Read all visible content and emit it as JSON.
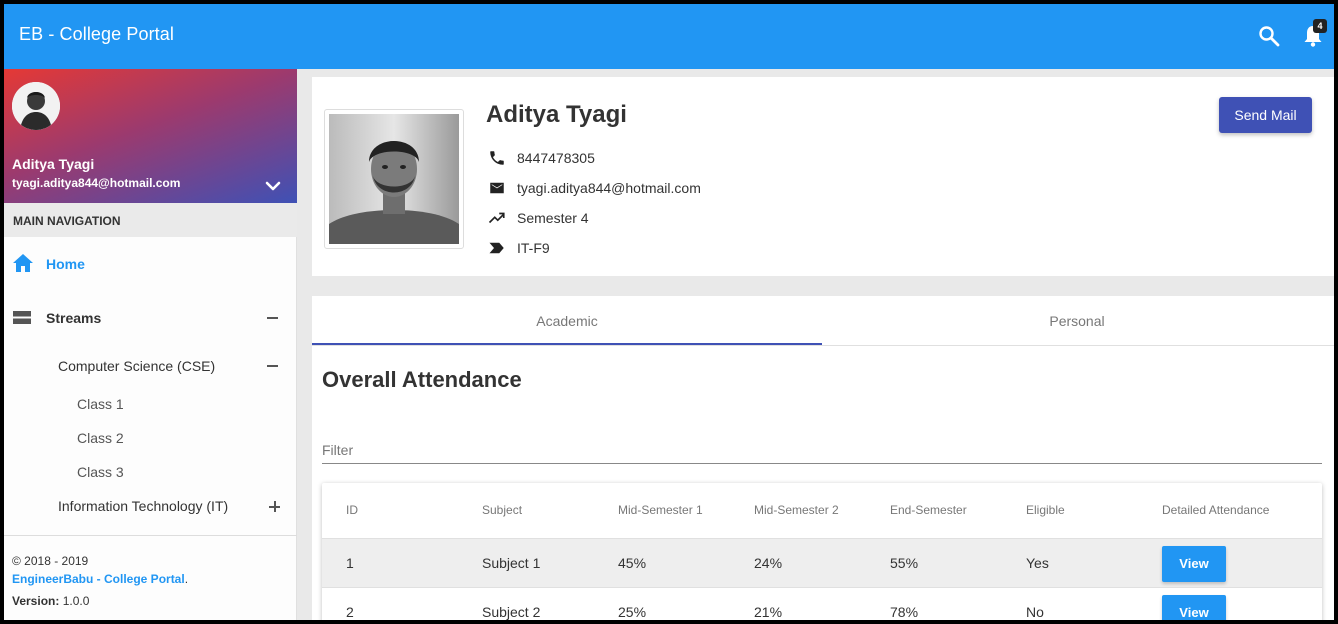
{
  "app": {
    "title": "EB - College Portal",
    "notification_count": "4"
  },
  "sidebar": {
    "user_name": "Aditya Tyagi",
    "user_email": "tyagi.aditya844@hotmail.com",
    "nav_header": "MAIN NAVIGATION",
    "home": "Home",
    "streams": "Streams",
    "cse": "Computer Science (CSE)",
    "classes": [
      "Class 1",
      "Class 2",
      "Class 3"
    ],
    "it": "Information Technology (IT)",
    "footer": {
      "copyright": "© 2018 - 2019",
      "link": "EngineerBabu - College Portal",
      "link_suffix": ".",
      "version_label": "Version:",
      "version": "1.0.0"
    }
  },
  "profile": {
    "name": "Aditya Tyagi",
    "phone": "8447478305",
    "email": "tyagi.aditya844@hotmail.com",
    "semester": "Semester 4",
    "section": "IT-F9",
    "send_mail": "Send Mail"
  },
  "tabs": [
    "Academic",
    "Personal"
  ],
  "attendance": {
    "title": "Overall Attendance",
    "filter_placeholder": "Filter",
    "columns": [
      "ID",
      "Subject",
      "Mid-Semester 1",
      "Mid-Semester 2",
      "End-Semester",
      "Eligible",
      "Detailed Attendance"
    ],
    "rows": [
      {
        "id": "1",
        "subject": "Subject 1",
        "mid1": "45%",
        "mid2": "24%",
        "end": "55%",
        "eligible": "Yes",
        "action": "View"
      },
      {
        "id": "2",
        "subject": "Subject 2",
        "mid1": "25%",
        "mid2": "21%",
        "end": "78%",
        "eligible": "No",
        "action": "View"
      }
    ]
  },
  "colors": {
    "primary": "#2196f3",
    "accent": "#3f51b5"
  }
}
